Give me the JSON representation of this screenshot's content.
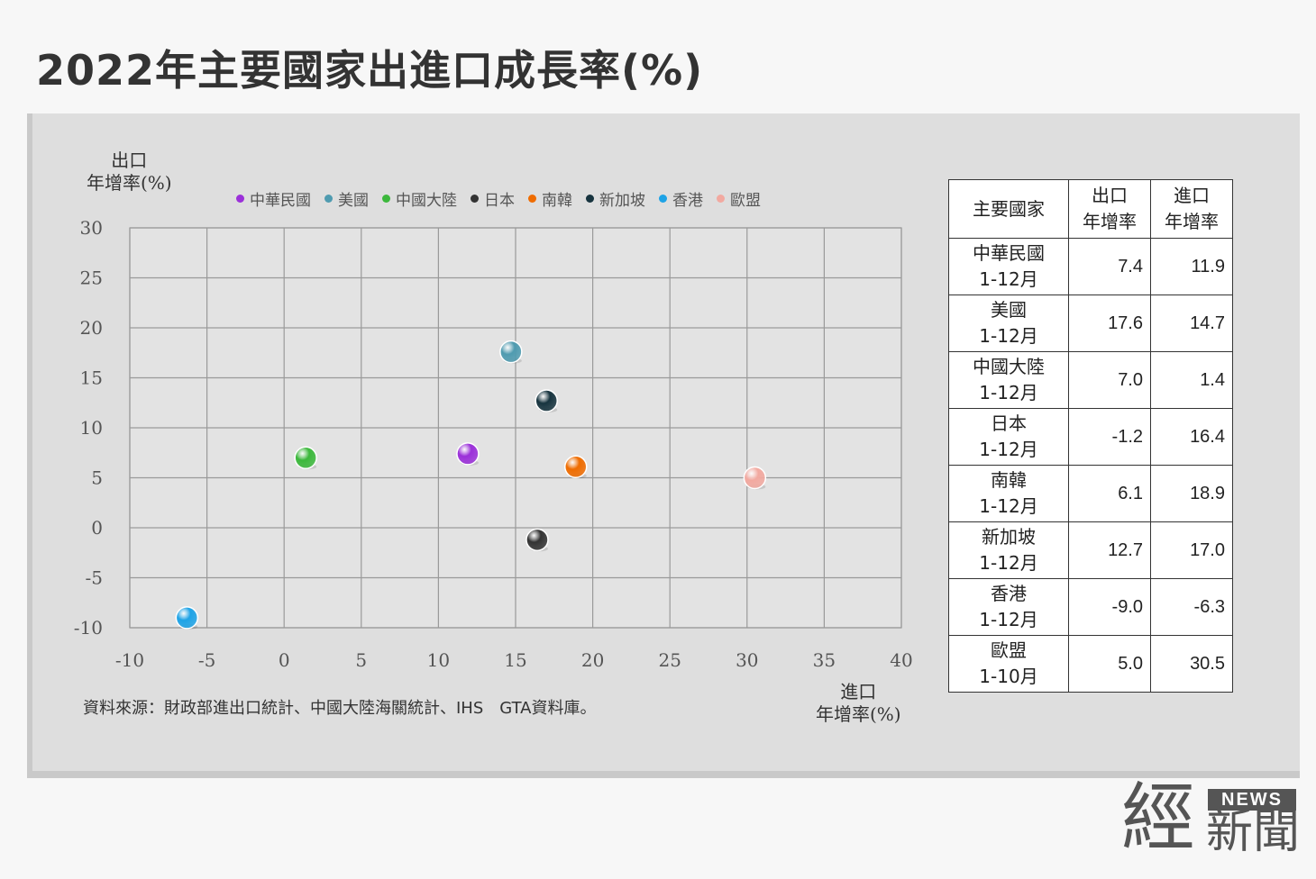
{
  "title": "2022年主要國家出進口成長率(%)",
  "y_unit": {
    "line1": "出口",
    "line2": "年增率(%)"
  },
  "x_unit": {
    "line1": "進口",
    "line2": "年增率(%)"
  },
  "source": "資料來源：財政部進出口統計、中國大陸海關統計、IHS　GTA資料庫。",
  "logo": {
    "big": "經",
    "news": "NEWS",
    "small": "新聞"
  },
  "table": {
    "headers": {
      "country": "主要國家",
      "export": [
        "出口",
        "年增率"
      ],
      "import": [
        "進口",
        "年增率"
      ]
    },
    "rows": [
      {
        "name": "中華民國",
        "period": "1-12月",
        "export": "7.4",
        "import": "11.9"
      },
      {
        "name": "美國",
        "period": "1-12月",
        "export": "17.6",
        "import": "14.7"
      },
      {
        "name": "中國大陸",
        "period": "1-12月",
        "export": "7.0",
        "import": "1.4"
      },
      {
        "name": "日本",
        "period": "1-12月",
        "export": "-1.2",
        "import": "16.4"
      },
      {
        "name": "南韓",
        "period": "1-12月",
        "export": "6.1",
        "import": "18.9"
      },
      {
        "name": "新加坡",
        "period": "1-12月",
        "export": "12.7",
        "import": "17.0"
      },
      {
        "name": "香港",
        "period": "1-12月",
        "export": "-9.0",
        "import": "-6.3"
      },
      {
        "name": "歐盟",
        "period": "1-10月",
        "export": "5.0",
        "import": "30.5"
      }
    ]
  },
  "chart_data": {
    "type": "scatter",
    "xlabel": "進口年增率(%)",
    "ylabel": "出口年增率(%)",
    "xlim": [
      -10,
      40
    ],
    "ylim": [
      -10,
      30
    ],
    "x_ticks": [
      "-10",
      "-5",
      "0",
      "5",
      "10",
      "15",
      "20",
      "25",
      "30",
      "35",
      "40"
    ],
    "y_ticks": [
      "30",
      "25",
      "20",
      "15",
      "10",
      "5",
      "0",
      "-5",
      "-10"
    ],
    "grid": true,
    "legend_position": "top",
    "series": [
      {
        "name": "中華民國",
        "x": 11.9,
        "y": 7.4,
        "color": "#9b30d9"
      },
      {
        "name": "美國",
        "x": 14.7,
        "y": 17.6,
        "color": "#4f9bb0"
      },
      {
        "name": "中國大陸",
        "x": 1.4,
        "y": 7.0,
        "color": "#3cb83c"
      },
      {
        "name": "日本",
        "x": 16.4,
        "y": -1.2,
        "color": "#333333"
      },
      {
        "name": "南韓",
        "x": 18.9,
        "y": 6.1,
        "color": "#ef6c00"
      },
      {
        "name": "新加坡",
        "x": 17.0,
        "y": 12.7,
        "color": "#17343f"
      },
      {
        "name": "香港",
        "x": -6.3,
        "y": -9.0,
        "color": "#1ea3e6"
      },
      {
        "name": "歐盟",
        "x": 30.5,
        "y": 5.0,
        "color": "#f2a9a0"
      }
    ]
  }
}
